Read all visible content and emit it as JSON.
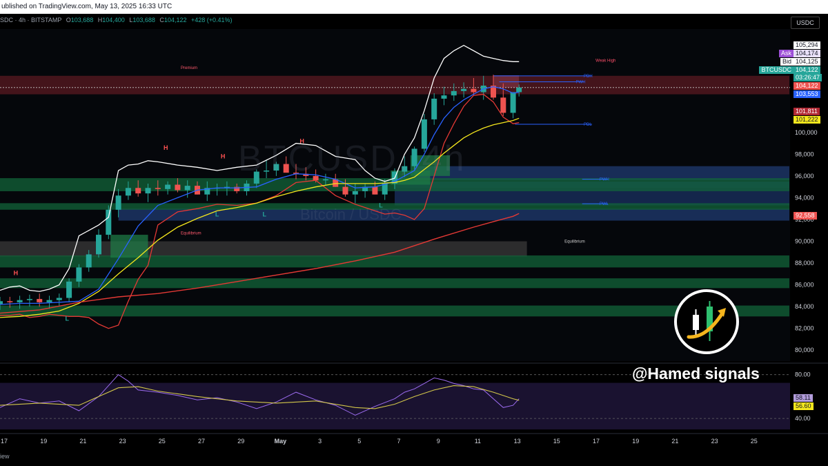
{
  "header": {
    "published": "ublished on TradingView.com, May 13, 2025 16:33 UTC",
    "symbol": "SDC · 4h · BITSTAMP",
    "ohlc": [
      {
        "label": "O",
        "value": "103,688"
      },
      {
        "label": "H",
        "value": "104,400"
      },
      {
        "label": "L",
        "value": "103,688"
      },
      {
        "label": "C",
        "value": "104,122"
      }
    ],
    "change": "+428 (+0.41%)",
    "currency": "USDC"
  },
  "watermark": {
    "title": "BTCUSD, 4h",
    "subtitle": "Bitcoin / USDC"
  },
  "branding": {
    "signal_text": "@Hamed signals",
    "logo_icon": "candlestick-arrow-logo-icon"
  },
  "status_bar": {
    "text": "iew"
  },
  "price_tags": [
    {
      "label": "",
      "value": "105,294",
      "bg": "#ffffff",
      "fg": "#131722"
    },
    {
      "label": "Ask",
      "value": "104,174",
      "bg": "#e8e0f8",
      "fg": "#131722",
      "label_bg": "#9c4fd6"
    },
    {
      "label": "Bid",
      "value": "104,125",
      "bg": "#ffffff",
      "fg": "#131722",
      "label_bg": "#ffffff"
    },
    {
      "label": "BTCUSDC",
      "value": "104,122",
      "bg": "#26a69a",
      "fg": "#ffffff",
      "label_bg": "#26a69a",
      "sub": "03:26:47"
    },
    {
      "label": "",
      "value": "104,122",
      "bg": "#ef5350",
      "fg": "#ffffff"
    },
    {
      "label": "",
      "value": "103,553",
      "bg": "#2962ff",
      "fg": "#ffffff"
    },
    {
      "label": "",
      "value": "101,811",
      "bg": "#b22833",
      "fg": "#ffffff"
    },
    {
      "label": "",
      "value": "101,222",
      "bg": "#f5e71d",
      "fg": "#131722"
    },
    {
      "label": "",
      "value": "92,558",
      "bg": "#ef5350",
      "fg": "#ffffff"
    }
  ],
  "rsi_tags": [
    {
      "value": "58.11",
      "bg": "#b39ddb",
      "fg": "#131722"
    },
    {
      "value": "56.60",
      "bg": "#f5e71d",
      "fg": "#131722"
    }
  ],
  "chart_data": {
    "type": "line",
    "price_axis": {
      "ylim": [
        79000,
        109500
      ],
      "ticks": [
        "80,000",
        "82,000",
        "84,000",
        "86,000",
        "88,000",
        "90,000",
        "92,000",
        "94,000",
        "96,000",
        "98,000",
        "100,000",
        "102,000"
      ],
      "tick_values": [
        80000,
        82000,
        84000,
        86000,
        88000,
        90000,
        92000,
        94000,
        96000,
        98000,
        100000,
        102000
      ]
    },
    "rsi_axis": {
      "ylim": [
        30,
        88
      ],
      "ticks": [
        "80.00",
        "40.00"
      ],
      "tick_values": [
        80,
        40
      ],
      "band": [
        30,
        70
      ]
    },
    "time_axis": {
      "xlim": [
        0,
        40
      ],
      "labels": [
        "17",
        "19",
        "21",
        "23",
        "25",
        "27",
        "29",
        "May",
        "3",
        "5",
        "7",
        "9",
        "11",
        "13",
        "15",
        "17",
        "19",
        "21",
        "23",
        "25"
      ],
      "positions": [
        0,
        2,
        4,
        6,
        8,
        10,
        12,
        14,
        16,
        18,
        20,
        22,
        24,
        26,
        28,
        30,
        32,
        34,
        36,
        38
      ]
    },
    "zones": [
      {
        "kind": "premium",
        "label": "Premium",
        "from": 103500,
        "to": 105200,
        "color": "#5a1a22",
        "x_end": 40
      },
      {
        "kind": "supply",
        "label": "",
        "from": 104100,
        "to": 105250,
        "color": "#7a3040",
        "x_end": 26.3,
        "x_start": 25
      },
      {
        "kind": "fvg",
        "label": "",
        "from": 95600,
        "to": 96900,
        "color": "#1f3b72",
        "x_start": 21,
        "x_end": 40
      },
      {
        "kind": "fvg",
        "label": "",
        "from": 94900,
        "to": 95500,
        "color": "#1f3b72",
        "x_start": 20,
        "x_end": 40
      },
      {
        "kind": "fvg",
        "label": "",
        "from": 93300,
        "to": 94900,
        "color": "#1a3262",
        "x_start": 20,
        "x_end": 40
      },
      {
        "kind": "fvg",
        "label": "",
        "from": 91900,
        "to": 93000,
        "color": "#1f3b72",
        "x_start": 6,
        "x_end": 40
      },
      {
        "kind": "demand",
        "label": "",
        "from": 94600,
        "to": 95800,
        "color": "#11643a",
        "x_start": 0,
        "x_end": 40
      },
      {
        "kind": "demand",
        "label": "",
        "from": 92900,
        "to": 93500,
        "color": "#11643a",
        "x_start": 0,
        "x_end": 40
      },
      {
        "kind": "equilibrium",
        "label": "Equilibrium",
        "from": 88600,
        "to": 90000,
        "color": "#3a3a3a",
        "x_start": 0,
        "x_end": 26.7
      },
      {
        "kind": "demand",
        "label": "",
        "from": 87600,
        "to": 88700,
        "color": "#11643a",
        "x_start": 0,
        "x_end": 40
      },
      {
        "kind": "demand",
        "label": "",
        "from": 85700,
        "to": 86600,
        "color": "#11643a",
        "x_start": 0,
        "x_end": 40
      },
      {
        "kind": "demand",
        "label": "",
        "from": 83100,
        "to": 84100,
        "color": "#11643a",
        "x_start": 0,
        "x_end": 40
      },
      {
        "kind": "ob",
        "label": "",
        "from": 88500,
        "to": 90600,
        "color": "#1d7a45",
        "x_start": 5.6,
        "x_end": 7.5
      },
      {
        "kind": "ob",
        "label": "",
        "from": 96000,
        "to": 97900,
        "color": "#1d7a45",
        "x_start": 20.8,
        "x_end": 22.8
      },
      {
        "kind": "ob",
        "label": "",
        "from": 95200,
        "to": 96500,
        "color": "#1d7a45",
        "x_start": 19.8,
        "x_end": 21.8
      }
    ],
    "levels": [
      {
        "label": "PDH",
        "value": 105200,
        "x_start": 25.0,
        "x_end": 30.0,
        "color": "#2962ff"
      },
      {
        "label": "PWH",
        "value": 104650,
        "x_start": 25.3,
        "x_end": 29.6,
        "color": "#2962ff"
      },
      {
        "label": "PDL",
        "value": 100750,
        "x_start": 26.1,
        "x_end": 30.0,
        "color": "#2962ff"
      },
      {
        "label": "PWH",
        "value": 95700,
        "x_start": 29.5,
        "x_end": 30.8,
        "color": "#2962ff"
      },
      {
        "label": "PWL",
        "value": 93450,
        "x_start": 29.5,
        "x_end": 30.8,
        "color": "#2962ff"
      },
      {
        "label": "Equilibrium",
        "value": 90000,
        "x_start": 26.7,
        "x_end": 28.5,
        "color": "#cccccc"
      },
      {
        "label": "Premium",
        "value": 106500,
        "x_start": 9.0,
        "x_end": 10.5,
        "color": "#ff4f6a"
      },
      {
        "label": "Weak High",
        "value": 106600,
        "x_start": 29.4,
        "x_end": 30.6,
        "color": "#ff4f6a"
      }
    ],
    "series": [
      {
        "name": "",
        "color": "#ffffff",
        "width": 1.3,
        "x": [
          0,
          0.5,
          1,
          1.5,
          2,
          2.5,
          3,
          3.5,
          4,
          4.5,
          5,
          5.5,
          6,
          6.5,
          7,
          7.5,
          8,
          9,
          10,
          11,
          12,
          13,
          14,
          15,
          16,
          17,
          18,
          18.5,
          19,
          19.5,
          20,
          20.5,
          21,
          21.5,
          22,
          22.5,
          23,
          23.5,
          24,
          24.5,
          25,
          25.5,
          26,
          26.3
        ],
        "y": [
          85500,
          85800,
          85900,
          85500,
          85400,
          85600,
          86000,
          87500,
          90500,
          91000,
          91500,
          92200,
          96500,
          97000,
          97100,
          97400,
          97300,
          97000,
          96800,
          96500,
          96800,
          97000,
          97900,
          99000,
          98800,
          97800,
          97500,
          96500,
          95800,
          95500,
          95800,
          98000,
          99500,
          102000,
          105000,
          106800,
          107500,
          108000,
          107500,
          107000,
          106800,
          106600,
          106500,
          106500
        ]
      },
      {
        "name": "",
        "color": "#e53935",
        "width": 1.3,
        "x": [
          0,
          0.5,
          1,
          1.5,
          2,
          2.5,
          3,
          3.5,
          4,
          4.5,
          5,
          5.5,
          6,
          6.5,
          7,
          7.5,
          8,
          9,
          10,
          11,
          12,
          13,
          14,
          15,
          16,
          17,
          18,
          18.5,
          19,
          19.5,
          20,
          20.5,
          21,
          21.5,
          22,
          22.5,
          23,
          23.5,
          24,
          24.5,
          25,
          25.5,
          26,
          26.3
        ],
        "y": [
          83200,
          83200,
          83300,
          83000,
          83100,
          83300,
          83200,
          83100,
          83100,
          83000,
          82400,
          82000,
          82300,
          84500,
          86500,
          87800,
          91500,
          92700,
          93000,
          93400,
          93300,
          93500,
          94200,
          95400,
          95600,
          94200,
          93400,
          93100,
          92800,
          92500,
          92600,
          92400,
          92000,
          93000,
          96000,
          99000,
          100800,
          102400,
          103400,
          103500,
          102800,
          101400,
          100800,
          100900
        ]
      },
      {
        "name": "",
        "color": "#2962ff",
        "width": 1.3,
        "x": [
          0,
          1,
          2,
          3,
          4,
          5,
          6,
          7,
          8,
          9,
          10,
          11,
          12,
          13,
          14,
          15,
          16,
          17,
          18,
          19,
          20,
          20.5,
          21,
          21.5,
          22,
          22.5,
          23,
          23.5,
          24,
          24.5,
          25,
          25.5,
          26,
          26.3
        ],
        "y": [
          84200,
          84300,
          84300,
          84400,
          84500,
          85600,
          88400,
          91400,
          93300,
          94000,
          94700,
          94900,
          94900,
          95000,
          95700,
          96200,
          96100,
          95700,
          94900,
          95000,
          95500,
          96000,
          96500,
          98000,
          99800,
          101300,
          102300,
          103000,
          103500,
          104000,
          104200,
          104000,
          103600,
          103700
        ]
      },
      {
        "name": "",
        "color": "#f5e71d",
        "width": 1.3,
        "x": [
          0,
          1,
          2,
          3,
          4,
          5,
          6,
          7,
          8,
          9,
          10,
          11,
          12,
          13,
          14,
          15,
          16,
          17,
          18,
          19,
          20,
          20.5,
          21,
          21.5,
          22,
          22.5,
          23,
          23.5,
          24,
          24.5,
          25,
          25.5,
          26,
          26.3
        ],
        "y": [
          83000,
          83100,
          83300,
          83600,
          84300,
          85400,
          87000,
          88500,
          90100,
          91300,
          92100,
          92800,
          93100,
          93500,
          94100,
          94600,
          95000,
          95300,
          95300,
          95300,
          95400,
          95600,
          95900,
          96600,
          97300,
          98100,
          98800,
          99500,
          100000,
          100400,
          100700,
          100900,
          101100,
          101300
        ]
      },
      {
        "name": "",
        "color": "#e53935",
        "width": 1.4,
        "x": [
          0,
          2,
          4,
          6,
          8,
          10,
          12,
          14,
          16,
          18,
          20,
          22,
          24,
          25,
          26,
          26.3
        ],
        "y": [
          83400,
          83700,
          84400,
          84900,
          85200,
          85700,
          86300,
          86900,
          87500,
          88200,
          89000,
          90200,
          91300,
          91800,
          92300,
          92550
        ]
      }
    ],
    "candles": {
      "x": [
        0,
        0.5,
        1,
        1.5,
        2,
        2.5,
        3,
        3.5,
        4,
        4.5,
        5,
        5.5,
        6,
        6.5,
        7,
        7.5,
        8,
        8.5,
        9,
        9.5,
        10,
        10.5,
        11,
        11.5,
        12,
        12.5,
        13,
        13.5,
        14,
        14.5,
        15,
        15.5,
        16,
        16.5,
        17,
        17.5,
        18,
        18.5,
        19,
        19.5,
        20,
        20.5,
        21,
        21.5,
        22,
        22.5,
        23,
        23.5,
        24,
        24.5,
        25,
        25.5,
        26,
        26.3
      ],
      "open": [
        84200,
        84500,
        84400,
        84600,
        84700,
        84400,
        84600,
        84800,
        86300,
        87600,
        88800,
        90600,
        92900,
        94200,
        94900,
        94400,
        94900,
        94800,
        95200,
        94700,
        95100,
        94300,
        94900,
        94900,
        95000,
        94600,
        95300,
        96400,
        96500,
        97100,
        96300,
        96200,
        96000,
        95600,
        95700,
        95000,
        94300,
        94600,
        95000,
        94300,
        95300,
        96400,
        96900,
        98500,
        101200,
        103100,
        103400,
        103800,
        104000,
        103700,
        104300,
        103200,
        101800,
        103700
      ],
      "high": [
        84900,
        84900,
        85000,
        85100,
        85200,
        85000,
        85200,
        86600,
        87900,
        89200,
        91100,
        93300,
        94800,
        95500,
        95600,
        95300,
        95600,
        95500,
        95800,
        95600,
        95500,
        95500,
        95300,
        95500,
        95300,
        95600,
        96600,
        97500,
        97300,
        97800,
        97100,
        96800,
        96600,
        96200,
        96200,
        95700,
        95300,
        95300,
        95500,
        95700,
        96700,
        97800,
        98700,
        101700,
        103600,
        104200,
        104500,
        104600,
        105000,
        105200,
        105300,
        104500,
        103400,
        104400
      ],
      "low": [
        83700,
        83900,
        83800,
        84000,
        84000,
        83800,
        84100,
        84400,
        85800,
        87200,
        88500,
        90200,
        92200,
        93800,
        94100,
        93600,
        94200,
        94300,
        94500,
        94000,
        94300,
        93700,
        94200,
        94200,
        94400,
        94200,
        94900,
        95800,
        96000,
        96500,
        95700,
        95600,
        95400,
        95200,
        95000,
        94100,
        93500,
        94000,
        94300,
        93800,
        94800,
        95900,
        96600,
        98200,
        100700,
        102500,
        102900,
        103200,
        103400,
        103000,
        103000,
        101500,
        101300,
        103300
      ],
      "close": [
        84500,
        84400,
        84600,
        84700,
        84400,
        84600,
        84800,
        86300,
        87600,
        88800,
        90600,
        92900,
        94200,
        94900,
        94400,
        94900,
        94800,
        95200,
        94700,
        95100,
        94300,
        94900,
        94900,
        95000,
        94600,
        95300,
        96400,
        96500,
        97100,
        96300,
        96200,
        96000,
        95600,
        95700,
        95000,
        94300,
        94600,
        95000,
        94300,
        95300,
        96400,
        96900,
        98500,
        101200,
        103100,
        103400,
        103800,
        104000,
        103700,
        104300,
        103200,
        101800,
        103700,
        104122
      ]
    },
    "rsi": {
      "x": [
        0,
        1,
        2,
        3,
        4,
        5,
        5.5,
        6,
        6.5,
        7,
        8,
        9,
        10,
        11,
        12,
        13,
        14,
        15,
        16,
        17,
        18,
        19,
        20,
        20.5,
        21,
        21.5,
        22,
        22.5,
        23,
        23.5,
        24,
        24.5,
        25,
        25.5,
        26,
        26.3
      ],
      "y": [
        50,
        58,
        54,
        56,
        47,
        60,
        70,
        80,
        74,
        66,
        64,
        61,
        57,
        59,
        55,
        49,
        55,
        64,
        57,
        52,
        43,
        51,
        58,
        64,
        67,
        72,
        77,
        75,
        72,
        70,
        67,
        66,
        58,
        50,
        52,
        58
      ],
      "ma_x": [
        0,
        2,
        4,
        5,
        6,
        7,
        8,
        10,
        12,
        14,
        16,
        18,
        19,
        20,
        21,
        22,
        23,
        24,
        25,
        26,
        26.3
      ],
      "ma_y": [
        52,
        54,
        52,
        60,
        68,
        69,
        65,
        60,
        56,
        54,
        56,
        50,
        49,
        53,
        60,
        66,
        70,
        69,
        64,
        58,
        56.6
      ]
    },
    "markers": [
      {
        "text": "H",
        "x": 0.8,
        "y": 86900,
        "color": "#ff5252"
      },
      {
        "text": "H",
        "x": 8.4,
        "y": 98400,
        "color": "#ff5252"
      },
      {
        "text": "H",
        "x": 11.3,
        "y": 97600,
        "color": "#ff5252"
      },
      {
        "text": "H",
        "x": 15.3,
        "y": 99000,
        "color": "#ff5252"
      },
      {
        "text": "L",
        "x": 3.4,
        "y": 82700,
        "color": "#26a69a"
      },
      {
        "text": "L",
        "x": 11.0,
        "y": 92300,
        "color": "#26a69a"
      },
      {
        "text": "L",
        "x": 13.4,
        "y": 92300,
        "color": "#26a69a"
      },
      {
        "text": "L",
        "x": 19.3,
        "y": 93100,
        "color": "#26a69a"
      }
    ]
  }
}
